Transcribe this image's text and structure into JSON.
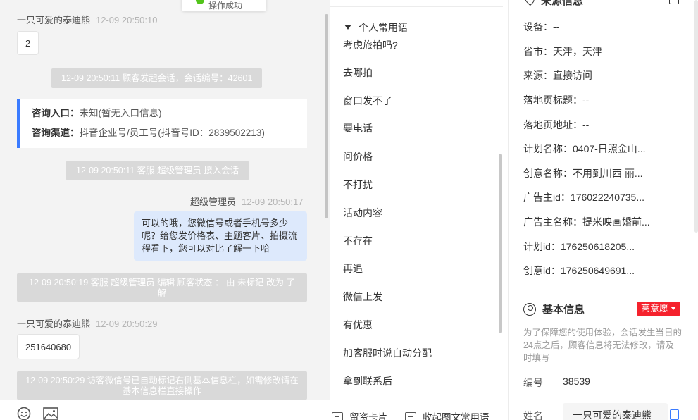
{
  "toast": {
    "text": "操作成功"
  },
  "chat": {
    "messages": [
      {
        "sender": "一只可爱的泰迪熊",
        "time": "12-09 20:50:10",
        "text": "2"
      },
      {
        "system": "12-09 20:50:11 顾客发起会话，会话编号：42601"
      },
      {
        "system": "12-09 20:50:11 客服 超级管理员 接入会话"
      },
      {
        "sender": "超级管理员",
        "time": "12-09 20:50:17",
        "text": "可以的哦，您微信号或者手机号多少呢？给您发价格表、主题客片、拍摄流程看下，您可以对比了解一下哈"
      },
      {
        "system": "12-09 20:50:19 客服 超级管理员 编辑 顾客状态 ： 由 未标记 改为 了解"
      },
      {
        "sender": "一只可爱的泰迪熊",
        "time": "12-09 20:50:29",
        "text": "251640680"
      },
      {
        "system": "12-09 20:50:29 访客微信号已自动标记右侧基本信息栏，如需修改请在基本信息栏直接操作"
      }
    ],
    "consult": {
      "entry_label": "咨询入口：",
      "entry_value": "未知(暂无入口信息)",
      "channel_label": "咨询渠道：",
      "channel_value": "抖音企业号/员工号(抖音号ID：2839502213)"
    },
    "toolbar": {
      "emoji_icon": "smiley-icon",
      "image_icon": "image-icon"
    }
  },
  "phrases": {
    "group": "个人常用语",
    "items": [
      "考虑旅拍吗?",
      "去哪拍",
      "窗口发不了",
      "要电话",
      "问价格",
      "不打扰",
      "活动内容",
      "不存在",
      "再追",
      "微信上发",
      "有优惠",
      "加客服时说自动分配",
      "拿到联系后"
    ],
    "toolbar": {
      "card": "留资卡片",
      "collapse": "收起图文常用语"
    }
  },
  "side": {
    "source_title": "来源信息",
    "source_fields": [
      {
        "label": "设备：",
        "value": "--"
      },
      {
        "label": "省市：",
        "value": "天津，天津"
      },
      {
        "label": "来源：",
        "value": "直接访问"
      },
      {
        "label": "落地页标题：",
        "value": "--"
      },
      {
        "label": "落地页地址：",
        "value": "--"
      },
      {
        "label": "计划名称：",
        "value": "0407-日照金山..."
      },
      {
        "label": "创意名称：",
        "value": "不用到川西 丽..."
      },
      {
        "label": "广告主id：",
        "value": "176022240735..."
      },
      {
        "label": "广告主名称：",
        "value": "提米映画婚前..."
      },
      {
        "label": "计划id：",
        "value": "176250618205..."
      },
      {
        "label": "创意id：",
        "value": "176250649691..."
      }
    ],
    "basic_title": "基本信息",
    "intent_badge": "高意愿",
    "notice": "为了保障您的使用体验，会话发生当日的24点之后，顾客信息将无法修改，请及时填写",
    "number_label": "编号",
    "number_value": "38539",
    "name_label": "姓名",
    "name_value": "一只可爱的泰迪熊",
    "colors": {
      "intent": "#f5222d",
      "accent": "#3a7bff"
    }
  }
}
